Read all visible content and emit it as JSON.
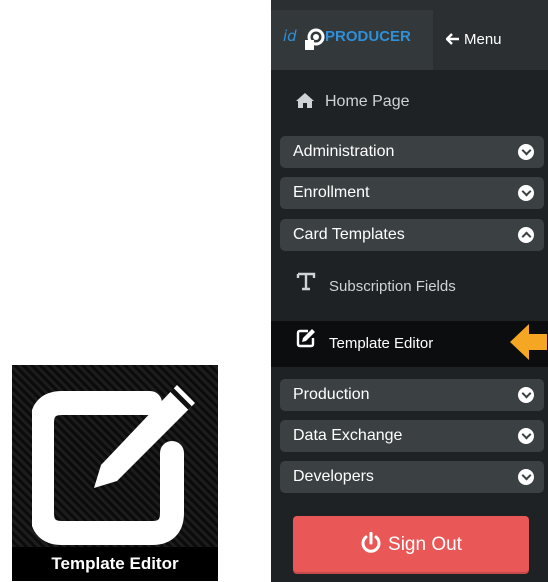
{
  "tile": {
    "label": "Template Editor",
    "icon": "edit-icon"
  },
  "sidebar": {
    "logo": {
      "prefix": "id",
      "name": "PRODUCER"
    },
    "menu_button": {
      "label": "Menu",
      "icon": "arrow-left-icon"
    },
    "home": {
      "label": "Home Page",
      "icon": "home-icon"
    },
    "sections": [
      {
        "label": "Administration",
        "expanded": false
      },
      {
        "label": "Enrollment",
        "expanded": false
      },
      {
        "label": "Card Templates",
        "expanded": true
      },
      {
        "label": "Production",
        "expanded": false
      },
      {
        "label": "Data Exchange",
        "expanded": false
      },
      {
        "label": "Developers",
        "expanded": false
      }
    ],
    "card_templates_items": [
      {
        "label": "Subscription Fields",
        "icon": "text-t-icon",
        "active": false
      },
      {
        "label": "Template Editor",
        "icon": "edit-icon",
        "active": true
      }
    ],
    "signout": {
      "label": "Sign Out",
      "icon": "power-icon",
      "color": "#e95856"
    }
  },
  "callout": {
    "icon": "arrow-left-icon",
    "color": "#f5a623"
  }
}
